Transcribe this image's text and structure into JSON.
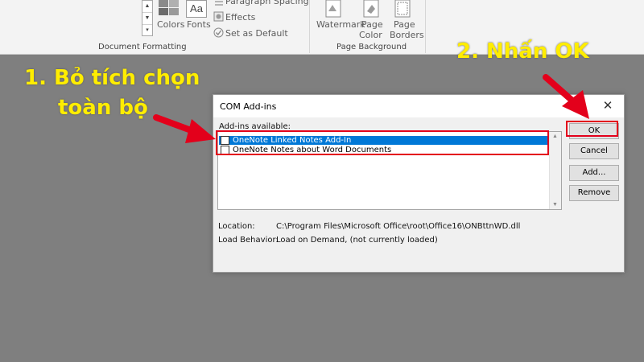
{
  "ribbon": {
    "colors_label": "Colors",
    "fonts_label": "Fonts",
    "paragraph_spacing_label": "Paragraph Spacing",
    "effects_label": "Effects",
    "set_default_label": "Set as Default",
    "watermark_label": "Watermark",
    "page_color_label_1": "Page",
    "page_color_label_2": "Color",
    "page_borders_label_1": "Page",
    "page_borders_label_2": "Borders",
    "fonts_icon_text": "Aa",
    "group_document_formatting": "Document Formatting",
    "group_page_background": "Page Background"
  },
  "annotations": {
    "step1_line1": "1. Bỏ tích chọn",
    "step1_line2": "toàn bộ",
    "step2": "2. Nhấn OK",
    "text_color": "#ffed00",
    "highlight_color": "#e3001b"
  },
  "dialog": {
    "title": "COM Add-ins",
    "close_glyph": "✕",
    "addins_available_label": "Add-ins available:",
    "addins": [
      {
        "label": "OneNote Linked Notes Add-In",
        "checked": false,
        "selected": true
      },
      {
        "label": "OneNote Notes about Word Documents",
        "checked": false,
        "selected": false
      }
    ],
    "buttons": {
      "ok": "OK",
      "cancel": "Cancel",
      "add": "Add...",
      "remove": "Remove"
    },
    "location_label": "Location:",
    "location_value": "C:\\Program Files\\Microsoft Office\\root\\Office16\\ONBttnWD.dll",
    "load_behavior_label": "Load Behavior:",
    "load_behavior_value": "Load on Demand, (not currently loaded)"
  },
  "colors": {
    "selection": "#0078d7",
    "backdrop": "#7f7f7f"
  }
}
